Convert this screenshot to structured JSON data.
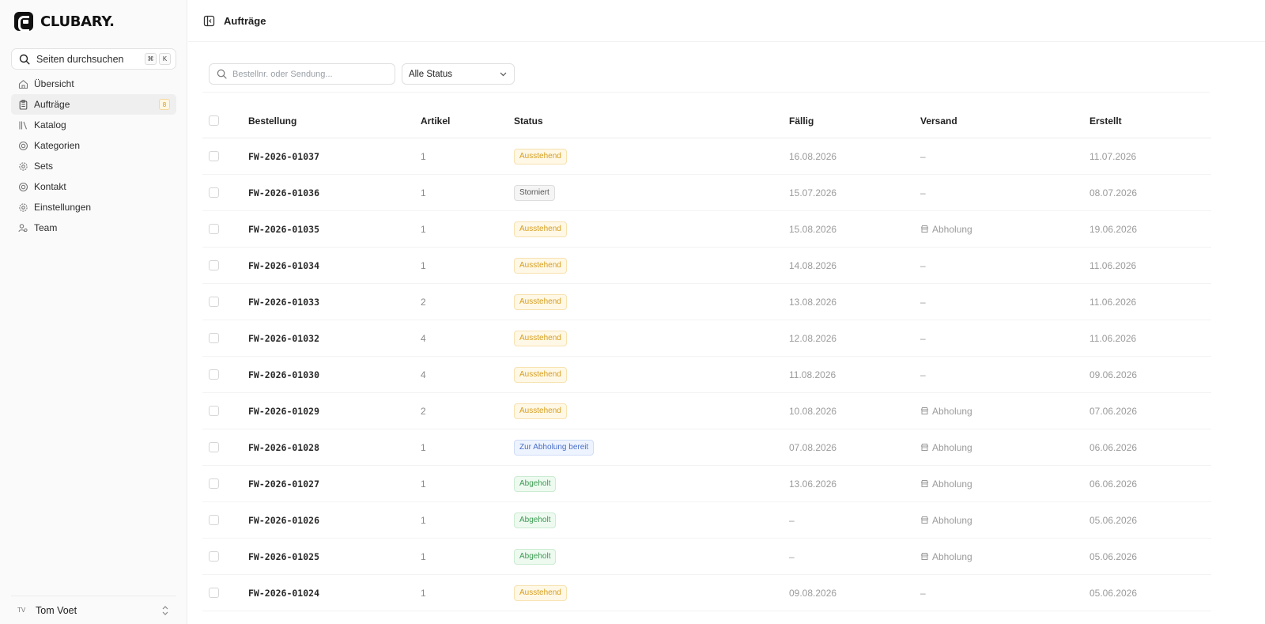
{
  "app": {
    "brand": "CLUBARY",
    "brand_dot": "."
  },
  "sidebar": {
    "search_label": "Seiten durchsuchen",
    "search_keys": [
      "⌘",
      "K"
    ],
    "items": [
      {
        "label": "Übersicht",
        "icon": "home-icon"
      },
      {
        "label": "Aufträge",
        "icon": "clipboard-icon",
        "badge": "8",
        "active": true
      },
      {
        "label": "Katalog",
        "icon": "book-icon"
      },
      {
        "label": "Kategorien",
        "icon": "lifebuoy-icon"
      },
      {
        "label": "Sets",
        "icon": "gear-icon"
      },
      {
        "label": "Kontakt",
        "icon": "lifebuoy-icon"
      },
      {
        "label": "Einstellungen",
        "icon": "gear-icon"
      },
      {
        "label": "Team",
        "icon": "users-icon"
      }
    ],
    "user": {
      "initials": "TV",
      "name": "Tom Voet"
    }
  },
  "header": {
    "title": "Aufträge"
  },
  "filters": {
    "search_placeholder": "Bestellnr. oder Sendung...",
    "status_value": "Alle Status"
  },
  "table": {
    "columns": [
      "Bestellung",
      "Artikel",
      "Status",
      "Fällig",
      "Versand",
      "Erstellt"
    ],
    "rows": [
      {
        "order": "FW-2026-01037",
        "items": "1",
        "status": "Ausstehend",
        "status_kind": "pending",
        "due": "16.08.2026",
        "shipping": "–",
        "created": "11.07.2026"
      },
      {
        "order": "FW-2026-01036",
        "items": "1",
        "status": "Storniert",
        "status_kind": "cancelled",
        "due": "15.07.2026",
        "shipping": "–",
        "created": "08.07.2026"
      },
      {
        "order": "FW-2026-01035",
        "items": "1",
        "status": "Ausstehend",
        "status_kind": "pending",
        "due": "15.08.2026",
        "shipping": "Abholung",
        "created": "19.06.2026"
      },
      {
        "order": "FW-2026-01034",
        "items": "1",
        "status": "Ausstehend",
        "status_kind": "pending",
        "due": "14.08.2026",
        "shipping": "–",
        "created": "11.06.2026"
      },
      {
        "order": "FW-2026-01033",
        "items": "2",
        "status": "Ausstehend",
        "status_kind": "pending",
        "due": "13.08.2026",
        "shipping": "–",
        "created": "11.06.2026"
      },
      {
        "order": "FW-2026-01032",
        "items": "4",
        "status": "Ausstehend",
        "status_kind": "pending",
        "due": "12.08.2026",
        "shipping": "–",
        "created": "11.06.2026"
      },
      {
        "order": "FW-2026-01030",
        "items": "4",
        "status": "Ausstehend",
        "status_kind": "pending",
        "due": "11.08.2026",
        "shipping": "–",
        "created": "09.06.2026"
      },
      {
        "order": "FW-2026-01029",
        "items": "2",
        "status": "Ausstehend",
        "status_kind": "pending",
        "due": "10.08.2026",
        "shipping": "Abholung",
        "created": "07.06.2026"
      },
      {
        "order": "FW-2026-01028",
        "items": "1",
        "status": "Zur Abholung bereit",
        "status_kind": "ready",
        "due": "07.08.2026",
        "shipping": "Abholung",
        "created": "06.06.2026"
      },
      {
        "order": "FW-2026-01027",
        "items": "1",
        "status": "Abgeholt",
        "status_kind": "picked",
        "due": "13.06.2026",
        "shipping": "Abholung",
        "created": "06.06.2026"
      },
      {
        "order": "FW-2026-01026",
        "items": "1",
        "status": "Abgeholt",
        "status_kind": "picked",
        "due": "–",
        "shipping": "Abholung",
        "created": "05.06.2026"
      },
      {
        "order": "FW-2026-01025",
        "items": "1",
        "status": "Abgeholt",
        "status_kind": "picked",
        "due": "–",
        "shipping": "Abholung",
        "created": "05.06.2026"
      },
      {
        "order": "FW-2026-01024",
        "items": "1",
        "status": "Ausstehend",
        "status_kind": "pending",
        "due": "09.08.2026",
        "shipping": "–",
        "created": "05.06.2026"
      }
    ]
  }
}
